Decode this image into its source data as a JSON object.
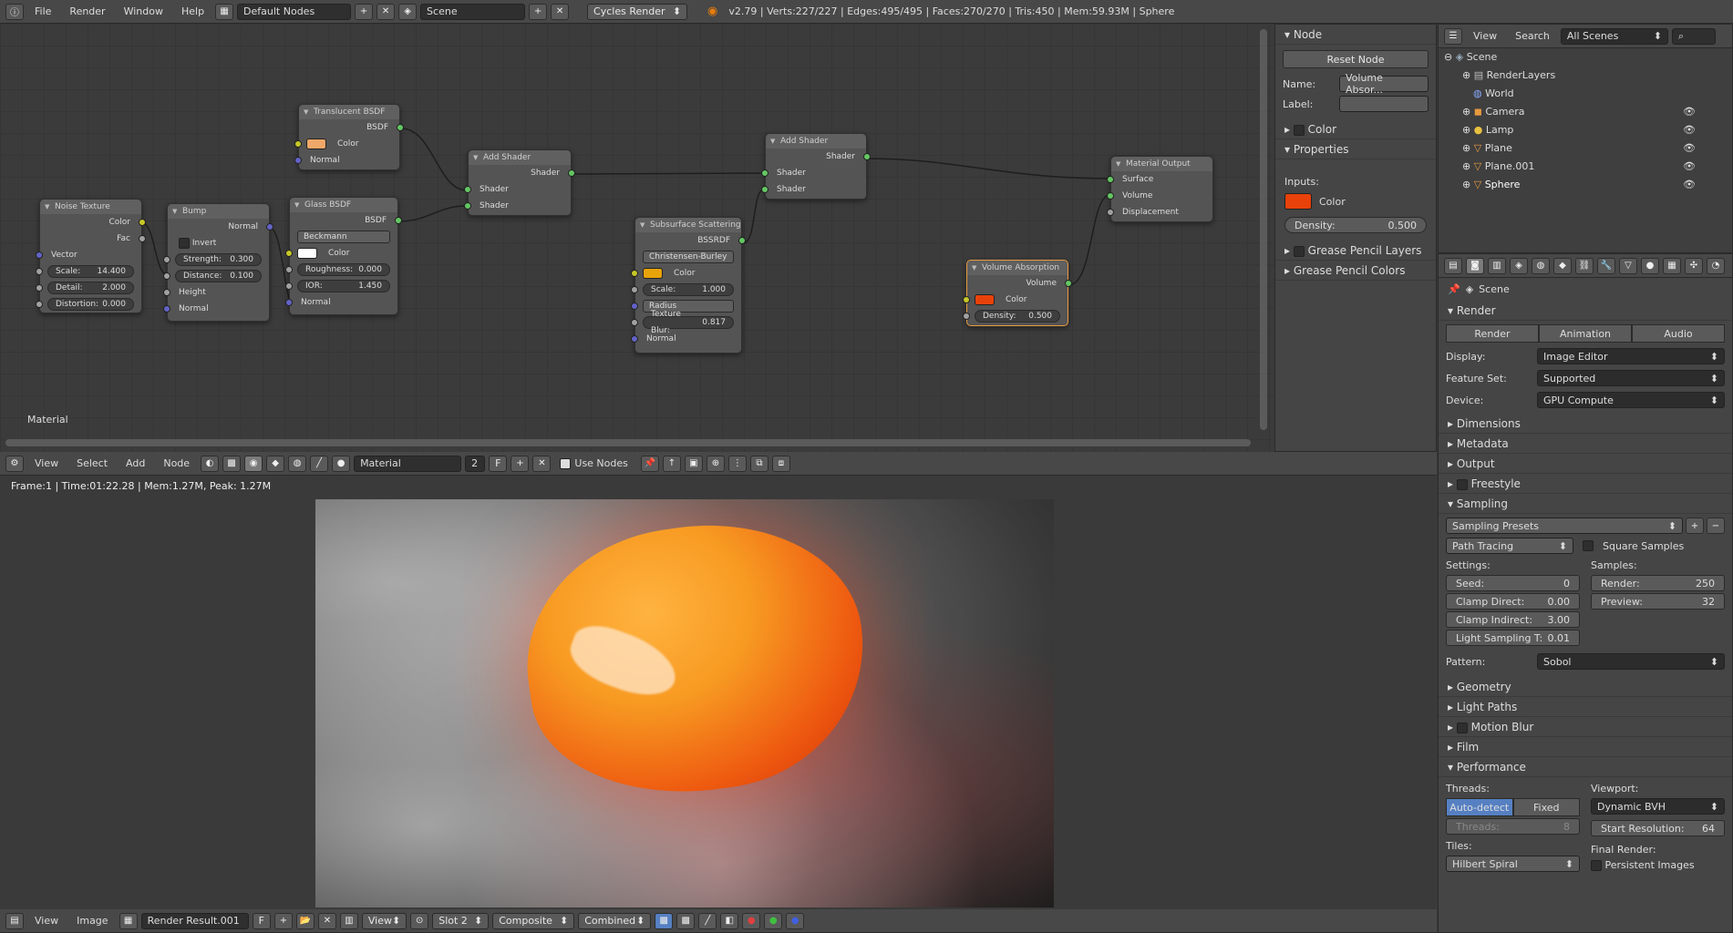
{
  "topbar": {
    "menus": [
      "File",
      "Render",
      "Window",
      "Help"
    ],
    "screen_layout": "Default Nodes",
    "scene": "Scene",
    "engine": "Cycles Render",
    "stats": "v2.79 | Verts:227/227 | Edges:495/495 | Faces:270/270 | Tris:450 | Mem:59.93M | Sphere"
  },
  "node_editor": {
    "context_label": "Material",
    "header": {
      "menus": [
        "View",
        "Select",
        "Add",
        "Node"
      ],
      "material": "Material",
      "users": "2",
      "fake": "F",
      "use_nodes": "Use Nodes"
    },
    "nodes": {
      "noise": {
        "title": "Noise Texture",
        "out_color": "Color",
        "out_fac": "Fac",
        "vector": "Vector",
        "scale_l": "Scale:",
        "scale_v": "14.400",
        "detail_l": "Detail:",
        "detail_v": "2.000",
        "distortion_l": "Distortion:",
        "distortion_v": "0.000"
      },
      "bump": {
        "title": "Bump",
        "out_normal": "Normal",
        "invert": "Invert",
        "strength_l": "Strength:",
        "strength_v": "0.300",
        "distance_l": "Distance:",
        "distance_v": "0.100",
        "height": "Height",
        "normal": "Normal"
      },
      "glass": {
        "title": "Glass BSDF",
        "out": "BSDF",
        "dist": "Beckmann",
        "color": "Color",
        "rough_l": "Roughness:",
        "rough_v": "0.000",
        "ior_l": "IOR:",
        "ior_v": "1.450",
        "normal": "Normal"
      },
      "translucent": {
        "title": "Translucent BSDF",
        "out": "BSDF",
        "color": "Color",
        "normal": "Normal"
      },
      "add1": {
        "title": "Add Shader",
        "out": "Shader",
        "in1": "Shader",
        "in2": "Shader"
      },
      "sss": {
        "title": "Subsurface Scattering",
        "out": "BSSRDF",
        "method": "Christensen-Burley",
        "color": "Color",
        "scale_l": "Scale:",
        "scale_v": "1.000",
        "radius": "Radius",
        "blur_l": "Texture Blur:",
        "blur_v": "0.817",
        "normal": "Normal"
      },
      "add2": {
        "title": "Add Shader",
        "out": "Shader",
        "in1": "Shader",
        "in2": "Shader"
      },
      "volabs": {
        "title": "Volume Absorption",
        "out": "Volume",
        "color": "Color",
        "density_l": "Density:",
        "density_v": "0.500"
      },
      "output": {
        "title": "Material Output",
        "surface": "Surface",
        "volume": "Volume",
        "displacement": "Displacement"
      }
    }
  },
  "node_props": {
    "title": "Node",
    "reset": "Reset Node",
    "name_label": "Name:",
    "name_value": "Volume Absor...",
    "label_label": "Label:",
    "color_section": "Color",
    "properties": "Properties",
    "inputs": "Inputs:",
    "color": "Color",
    "density_l": "Density:",
    "density_v": "0.500",
    "grease_layers": "Grease Pencil Layers",
    "grease_colors": "Grease Pencil Colors"
  },
  "outliner": {
    "menus": [
      "View",
      "Search"
    ],
    "filter": "All Scenes",
    "items": [
      "Scene",
      "RenderLayers",
      "World",
      "Camera",
      "Lamp",
      "Plane",
      "Plane.001",
      "Sphere"
    ]
  },
  "properties": {
    "context": "Scene",
    "render_section": "Render",
    "tabs": [
      "Render",
      "Animation",
      "Audio"
    ],
    "display_l": "Display:",
    "display_v": "Image Editor",
    "feature_l": "Feature Set:",
    "feature_v": "Supported",
    "device_l": "Device:",
    "device_v": "GPU Compute",
    "collapsed1": [
      "Dimensions",
      "Metadata",
      "Output",
      "Freestyle"
    ],
    "sampling": "Sampling",
    "presets": "Sampling Presets",
    "integrator": "Path Tracing",
    "square": "Square Samples",
    "settings": "Settings:",
    "samples": "Samples:",
    "seed_l": "Seed:",
    "seed_v": "0",
    "clamp_d_l": "Clamp Direct:",
    "clamp_d_v": "0.00",
    "clamp_i_l": "Clamp Indirect:",
    "clamp_i_v": "3.00",
    "light_l": "Light Sampling T:",
    "light_v": "0.01",
    "render_l": "Render:",
    "render_v": "250",
    "preview_l": "Preview:",
    "preview_v": "32",
    "pattern_l": "Pattern:",
    "pattern_v": "Sobol",
    "collapsed2": [
      "Geometry",
      "Light Paths",
      "Motion Blur",
      "Film"
    ],
    "performance": "Performance",
    "threads": "Threads:",
    "autodetect": "Auto-detect",
    "fixed": "Fixed",
    "threads_l": "Threads:",
    "threads_v": "8",
    "viewport": "Viewport:",
    "viewport_v": "Dynamic BVH",
    "startres_l": "Start Resolution:",
    "startres_v": "64",
    "tiles": "Tiles:",
    "tiles_v": "Hilbert Spiral",
    "final_render": "Final Render:",
    "persistent": "Persistent Images"
  },
  "image_editor": {
    "info": "Frame:1 | Time:01:22.28 | Mem:1.27M, Peak: 1.27M",
    "menus": [
      "View",
      "Image"
    ],
    "image": "Render Result.001",
    "fake": "F",
    "view": "View",
    "slot": "Slot 2",
    "pass": "Composite",
    "layer": "Combined"
  }
}
